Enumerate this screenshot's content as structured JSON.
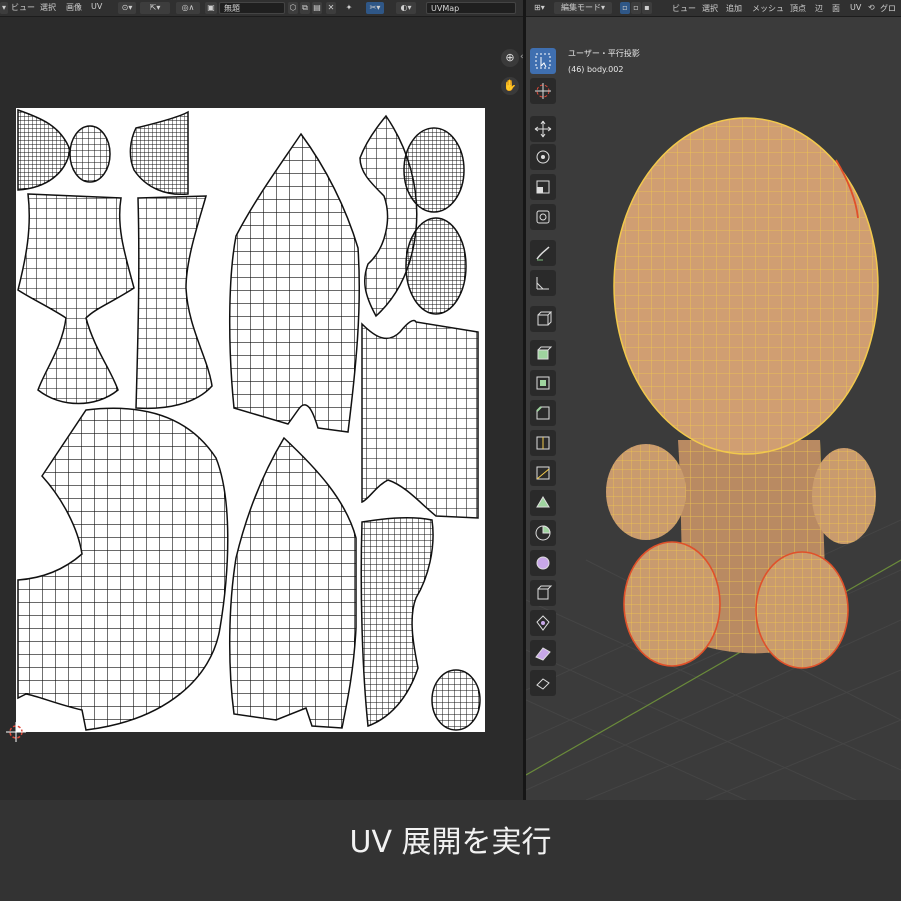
{
  "uv_editor": {
    "menus": [
      "ビュー",
      "選択",
      "画像",
      "UV"
    ],
    "uv_map_field": "UVMap",
    "image_field": "無題"
  },
  "viewport": {
    "edit_mode": "編集モード",
    "menus": [
      "ビュー",
      "選択",
      "追加",
      "メッシュ",
      "頂点",
      "辺",
      "面",
      "UV"
    ],
    "truncated_label": "グロ",
    "view_label": "ユーザー・平行投影",
    "object_label": "(46) body.002"
  },
  "caption": "UV 展開を実行",
  "colors": {
    "uv_background": "#ffffff",
    "wire": "#111111",
    "mesh_fill": "#c99b6e",
    "mesh_edge": "#f2c94c",
    "seam": "#e0502a",
    "active_tool": "#3f6fb0",
    "viewport_bg": "#3b3b3b"
  },
  "icons": {
    "toolbar": [
      "select-box-icon",
      "cursor-icon",
      "move-icon",
      "rotate-icon",
      "scale-icon",
      "transform-icon",
      "annotate-icon",
      "measure-icon",
      "add-cube-icon",
      "extrude-icon",
      "inset-icon",
      "bevel-icon",
      "loop-cut-icon",
      "knife-icon",
      "poly-build-icon",
      "spin-icon",
      "smooth-icon",
      "edge-slide-icon",
      "shrink-fatten-icon",
      "shear-icon",
      "rip-icon"
    ]
  }
}
